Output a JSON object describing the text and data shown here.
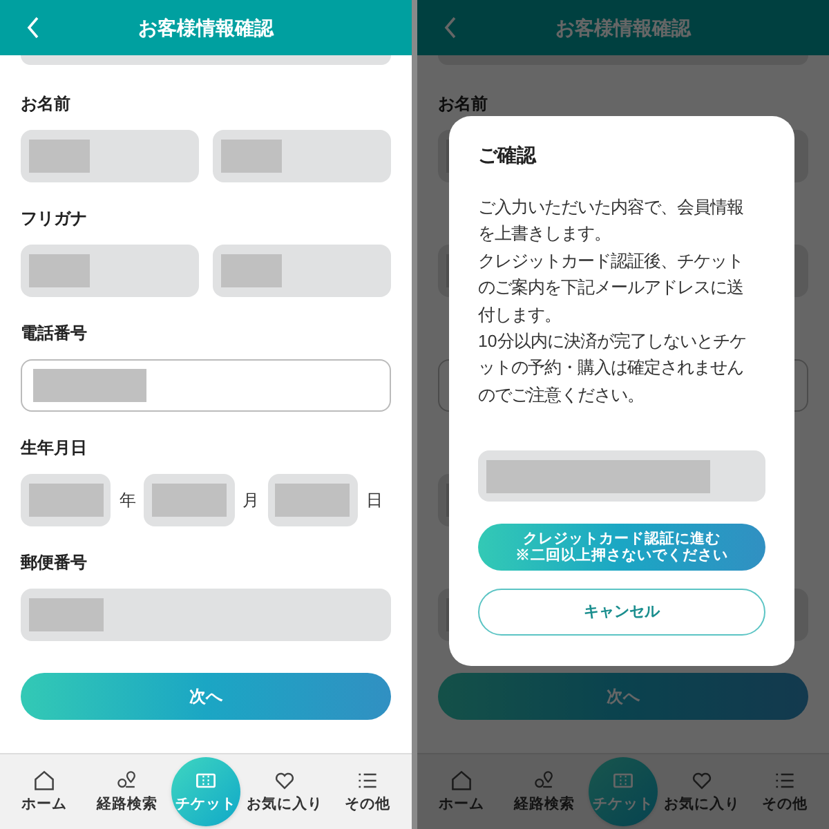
{
  "screens": [
    {
      "dimmed": false,
      "header": {
        "title": "お客様情報確認"
      },
      "form": [
        {
          "kind": "pair",
          "label": "お名前"
        },
        {
          "kind": "pair",
          "label": "フリガナ"
        },
        {
          "kind": "outlined",
          "label": "電話番号"
        },
        {
          "kind": "date",
          "label": "生年月日",
          "units": [
            "年",
            "月",
            "日"
          ]
        },
        {
          "kind": "single",
          "label": "郵便番号"
        }
      ],
      "next_button": "次へ",
      "nav": [
        {
          "kind": "home",
          "label": "ホーム",
          "selected": false
        },
        {
          "kind": "route",
          "label": "経路検索",
          "selected": false
        },
        {
          "kind": "ticket",
          "label": "チケット",
          "selected": true
        },
        {
          "kind": "heart",
          "label": "お気に入り",
          "selected": false
        },
        {
          "kind": "list",
          "label": "その他",
          "selected": false
        }
      ]
    },
    {
      "dimmed": true,
      "header": {
        "title": "お客様情報確認"
      },
      "form": [
        {
          "kind": "pair",
          "label": "お名前"
        },
        {
          "kind": "pair"
        },
        {
          "kind": "outlined"
        },
        {
          "kind": "date"
        },
        {
          "kind": "single"
        }
      ],
      "next_button": "次へ",
      "nav": [
        {
          "kind": "home",
          "label": "ホーム",
          "selected": false
        },
        {
          "kind": "route",
          "label": "経路検索",
          "selected": false
        },
        {
          "kind": "ticket",
          "label": "チケット",
          "selected": true
        },
        {
          "kind": "heart",
          "label": "お気に入り",
          "selected": false
        },
        {
          "kind": "list",
          "label": "その他",
          "selected": false
        }
      ]
    }
  ],
  "dialog": {
    "title": "ご確認",
    "message": [
      "ご入力いただいた内容で、会員情報を上書きします。",
      "クレジットカード認証後、チケットのご案内を下記メールアドレスに送付します。",
      "10分以内に決済が完了しないとチケットの予約・購入は確定されませんのでご注意ください。"
    ],
    "confirm_button": [
      "クレジットカード認証に進む",
      "※二回以上押さないでください"
    ],
    "cancel_button": "キャンセル"
  }
}
